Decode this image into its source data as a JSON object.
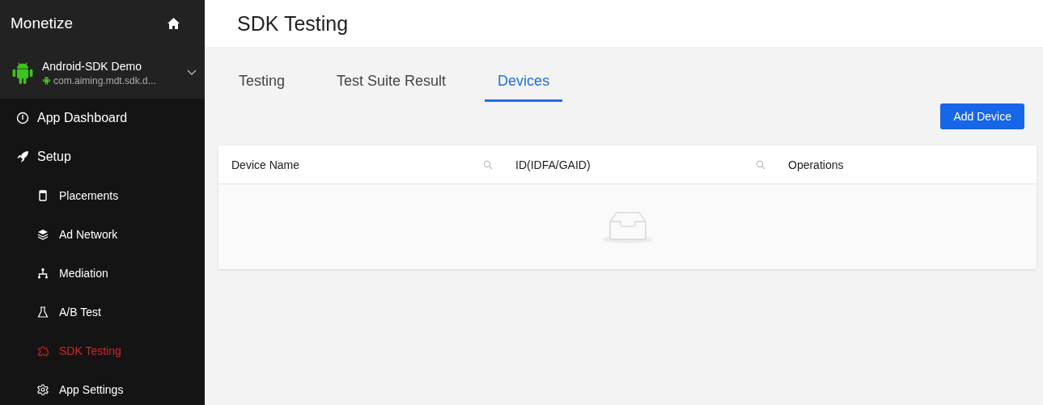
{
  "sidebar": {
    "brand": "Monetize",
    "app": {
      "name": "Android-SDK Demo",
      "package": "com.aiming.mdt.sdk.d..."
    },
    "items": [
      {
        "label": "App Dashboard",
        "kind": "top",
        "selected": false
      },
      {
        "label": "Setup",
        "kind": "top",
        "selected": false
      },
      {
        "label": "Placements",
        "kind": "sub",
        "selected": false
      },
      {
        "label": "Ad Network",
        "kind": "sub",
        "selected": false
      },
      {
        "label": "Mediation",
        "kind": "sub",
        "selected": false
      },
      {
        "label": "A/B Test",
        "kind": "sub",
        "selected": false
      },
      {
        "label": "SDK Testing",
        "kind": "sub",
        "selected": true
      },
      {
        "label": "App Settings",
        "kind": "sub",
        "selected": false
      }
    ]
  },
  "page": {
    "title": "SDK Testing"
  },
  "tabs": [
    {
      "label": "Testing",
      "selected": false
    },
    {
      "label": "Test Suite Result",
      "selected": false
    },
    {
      "label": "Devices",
      "selected": true
    }
  ],
  "add_button": "Add Device",
  "table": {
    "columns": [
      {
        "label": "Device Name",
        "searchable": true
      },
      {
        "label": "ID(IDFA/GAID)",
        "searchable": true
      },
      {
        "label": "Operations",
        "searchable": false
      }
    ]
  }
}
